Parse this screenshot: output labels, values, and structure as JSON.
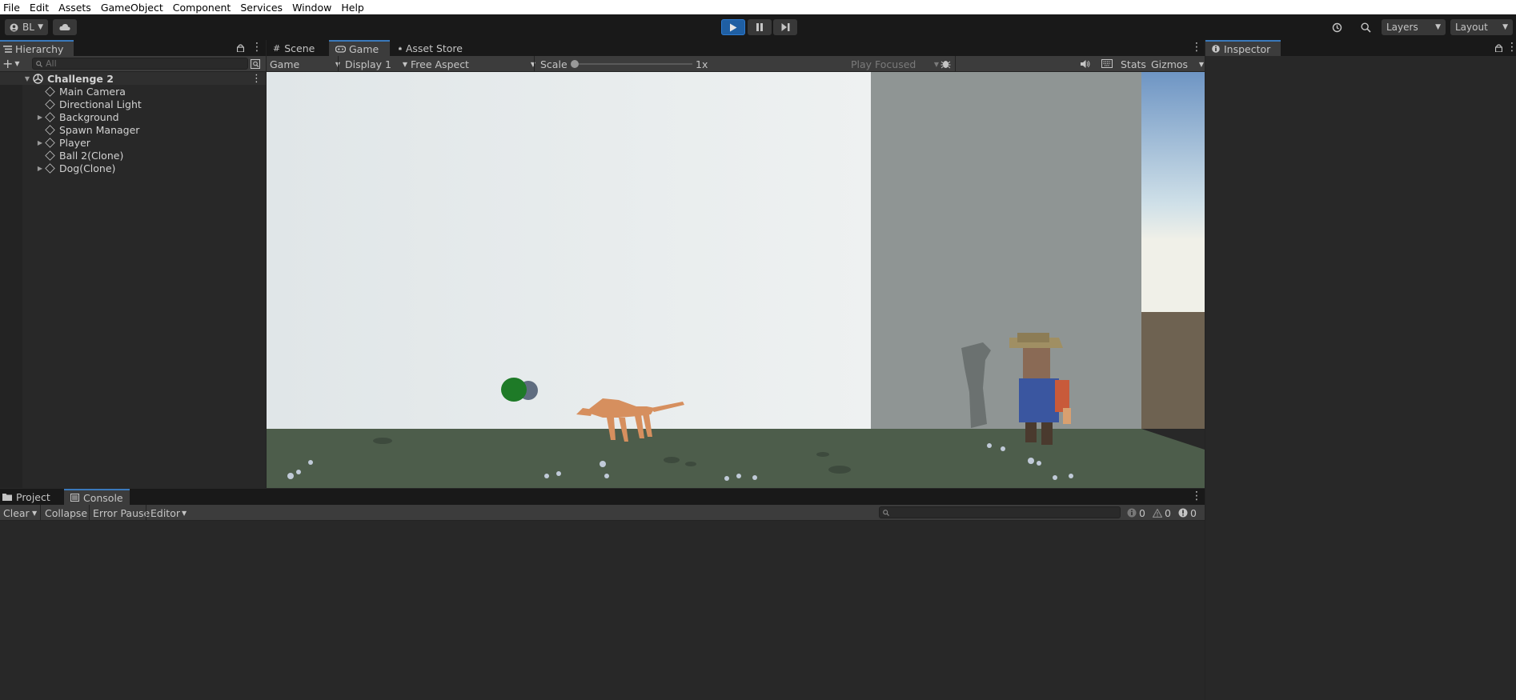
{
  "menu": [
    "File",
    "Edit",
    "Assets",
    "GameObject",
    "Component",
    "Services",
    "Window",
    "Help"
  ],
  "toolbar": {
    "account_label": "BL",
    "layers_label": "Layers",
    "layout_label": "Layout"
  },
  "hierarchy": {
    "tab_label": "Hierarchy",
    "search_placeholder": "All",
    "scene_name": "Challenge 2",
    "items": [
      {
        "label": "Main Camera",
        "expandable": false
      },
      {
        "label": "Directional Light",
        "expandable": false
      },
      {
        "label": "Background",
        "expandable": true
      },
      {
        "label": "Spawn Manager",
        "expandable": false
      },
      {
        "label": "Player",
        "expandable": true
      },
      {
        "label": "Ball 2(Clone)",
        "expandable": false
      },
      {
        "label": "Dog(Clone)",
        "expandable": true
      }
    ]
  },
  "center_tabs": [
    "Scene",
    "Game",
    "Asset Store"
  ],
  "game_bar": {
    "mode": "Game",
    "display": "Display 1",
    "aspect": "Free Aspect",
    "scale_label": "Scale",
    "scale_value": "1x",
    "play_focused": "Play Focused",
    "stats": "Stats",
    "gizmos": "Gizmos"
  },
  "inspector": {
    "tab_label": "Inspector"
  },
  "bottom_tabs": [
    "Project",
    "Console"
  ],
  "console": {
    "clear": "Clear",
    "collapse": "Collapse",
    "error_pause": "Error Pause",
    "editor": "Editor",
    "log_count": "0",
    "warn_count": "0",
    "error_count": "0"
  },
  "colors": {
    "accent": "#3a79bb",
    "sky": "#e3e8ea",
    "ground": "#4d5d4b",
    "wall": "#8f9594"
  }
}
